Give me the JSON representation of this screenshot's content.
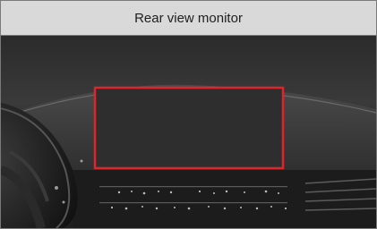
{
  "header": {
    "title": "Rear view monitor"
  },
  "illustration": {
    "description_icon": "car-dashboard-image",
    "highlight": {
      "name": "rear-view-monitor-screen",
      "outline_color": "#e0242b"
    }
  }
}
